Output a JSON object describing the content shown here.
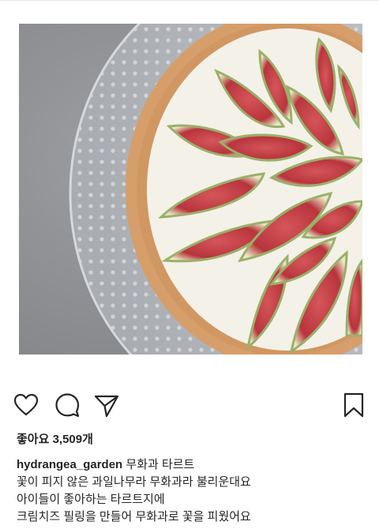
{
  "post": {
    "image_alt": "fig tart on glass cake stand",
    "likes_label": "좋아요 3,509개",
    "username": "hydrangea_garden",
    "caption_title": "무화과 타르트",
    "caption_lines": [
      "꽃이 피지 않은 과일나무라 무화과라 불리운대요",
      "아이들이 좋아하는 타르트지에",
      "크림치즈 필링을 만들어 무화과로 꽃을 피웠어요"
    ]
  },
  "icons": {
    "like": "heart-icon",
    "comment": "comment-icon",
    "share": "send-icon",
    "save": "bookmark-icon"
  }
}
